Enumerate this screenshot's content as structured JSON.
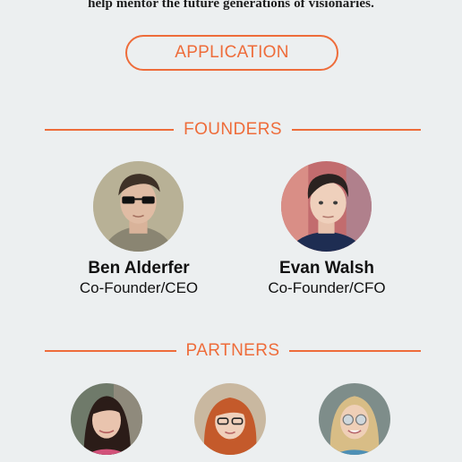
{
  "intro": {
    "text": "help mentor the future generations of visionaries."
  },
  "application_button": {
    "label": "APPLICATION"
  },
  "founders": {
    "heading": "FOUNDERS",
    "people": [
      {
        "name": "Ben Alderfer",
        "role": "Co-Founder/CEO",
        "photo": "ben-alderfer-photo"
      },
      {
        "name": "Evan Walsh",
        "role": "Co-Founder/CFO",
        "photo": "evan-walsh-photo"
      }
    ]
  },
  "partners": {
    "heading": "PARTNERS",
    "people": [
      {
        "photo": "partner-1-photo"
      },
      {
        "photo": "partner-2-photo"
      },
      {
        "photo": "partner-3-photo"
      }
    ]
  },
  "colors": {
    "accent": "#ee6c3a",
    "background": "#eceff0",
    "text": "#111111"
  }
}
